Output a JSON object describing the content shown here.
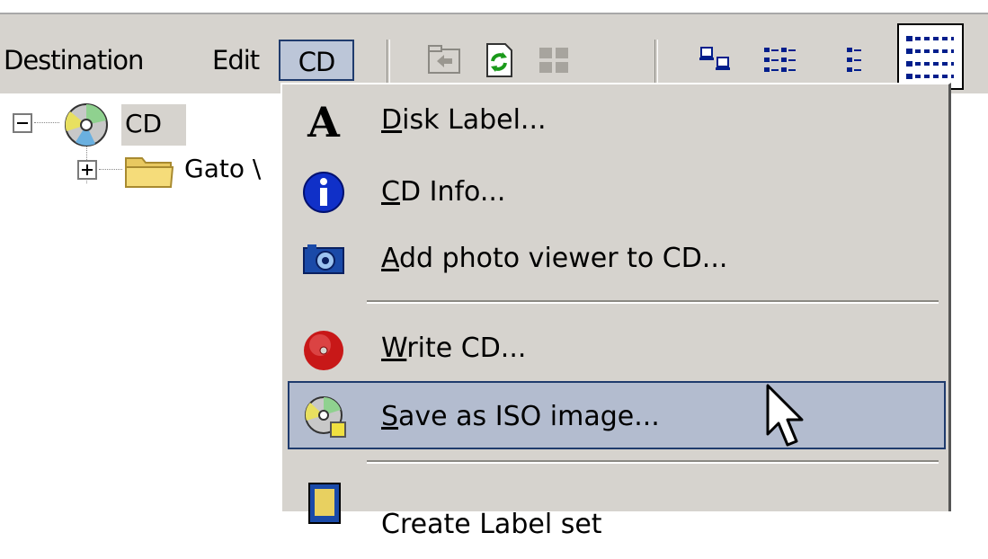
{
  "menubar": {
    "items": [
      {
        "label": "Destination"
      },
      {
        "label": "Edit"
      },
      {
        "label": "CD",
        "active": true
      }
    ],
    "toolbar_icons": [
      "folder-up-icon",
      "refresh-icon",
      "tiles-view-icon",
      "large-icons-view-icon",
      "small-icons-view-icon",
      "list-view-icon",
      "details-view-icon"
    ]
  },
  "tree": {
    "root": {
      "label": "CD",
      "icon": "cd-icon",
      "expanded": true
    },
    "children": [
      {
        "label": "Gato \\",
        "icon": "folder-icon",
        "expanded": false
      }
    ]
  },
  "cd_menu": {
    "items": [
      {
        "mnemonic": "D",
        "rest": "isk Label...",
        "icon": "font-a-icon"
      },
      {
        "mnemonic": "C",
        "rest": "D Info...",
        "icon": "info-icon"
      },
      {
        "mnemonic": "A",
        "rest": "dd photo viewer to CD...",
        "icon": "camera-icon"
      },
      {
        "mnemonic": "W",
        "rest": "rite CD...",
        "icon": "record-disc-icon"
      },
      {
        "mnemonic": "S",
        "rest": "ave as ISO image...",
        "icon": "cd-save-icon",
        "highlighted": true
      },
      {
        "mnemonic": "",
        "rest": "Create Label set",
        "icon": "label-set-icon"
      }
    ]
  },
  "colors": {
    "menu_face": "#d6d3ce",
    "highlight_fill": "#b3bccf",
    "highlight_border": "#1f3b6d",
    "info_blue": "#1030c8",
    "disc_red": "#c81818"
  }
}
